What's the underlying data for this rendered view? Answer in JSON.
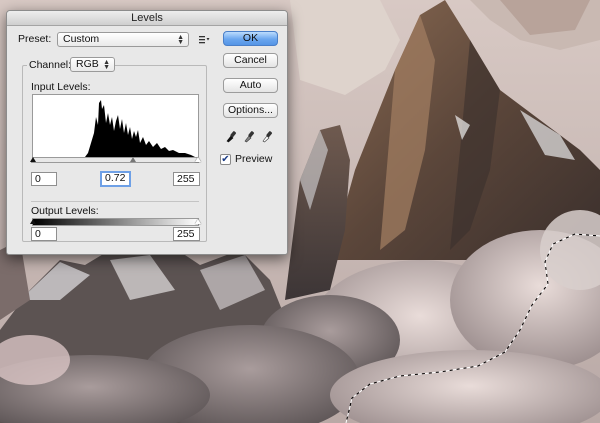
{
  "dialog": {
    "title": "Levels",
    "preset_label": "Preset:",
    "preset_value": "Custom",
    "channel_label": "Channel:",
    "channel_value": "RGB",
    "input_levels_label": "Input Levels:",
    "input_black": "0",
    "input_gamma": "0.72",
    "input_white": "255",
    "output_levels_label": "Output Levels:",
    "output_black": "0",
    "output_white": "255",
    "buttons": {
      "ok": "OK",
      "cancel": "Cancel",
      "auto": "Auto",
      "options": "Options..."
    },
    "preview_label": "Preview",
    "preview_checked": true,
    "eyedroppers": [
      "black-eyedropper-icon",
      "gray-eyedropper-icon",
      "white-eyedropper-icon"
    ]
  },
  "colors": {
    "default_button": "#6aa6ee",
    "focus_ring": "#6ea0e6"
  }
}
